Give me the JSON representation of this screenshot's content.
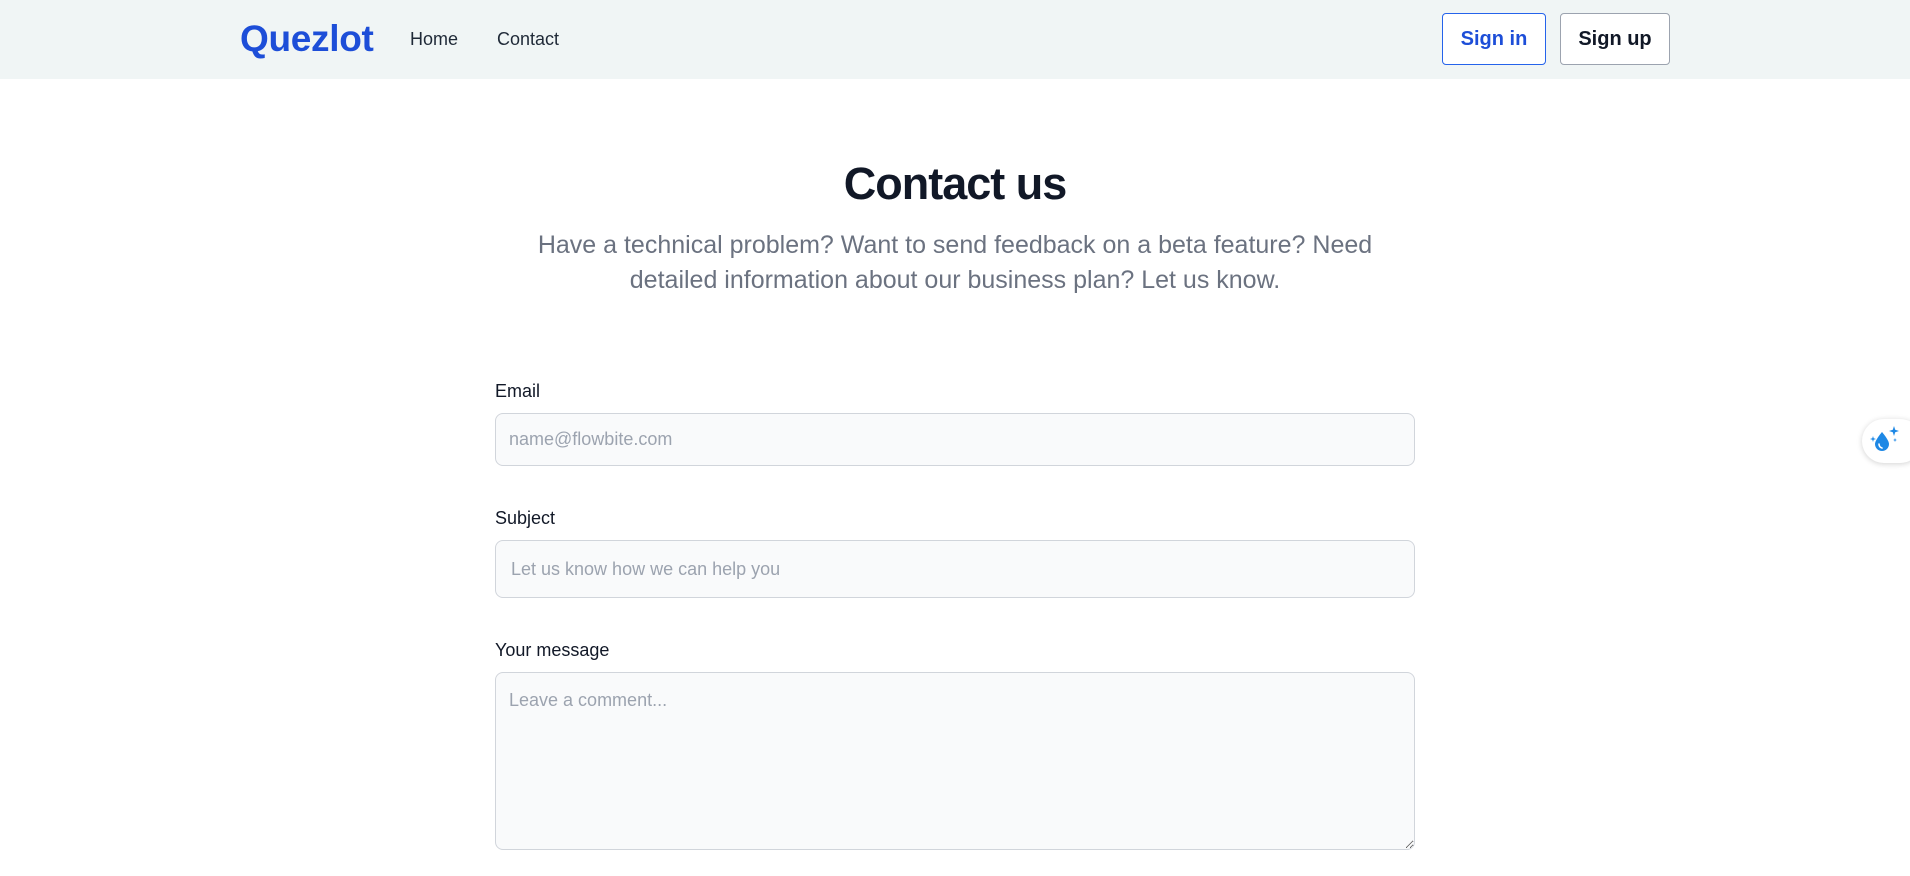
{
  "navbar": {
    "brand": "Quezlot",
    "links": [
      {
        "label": "Home"
      },
      {
        "label": "Contact"
      }
    ],
    "signin_label": "Sign in",
    "signup_label": "Sign up"
  },
  "header": {
    "title": "Contact us",
    "subtitle": "Have a technical problem? Want to send feedback on a beta feature? Need detailed information about our business plan? Let us know."
  },
  "form": {
    "email": {
      "label": "Email",
      "placeholder": "name@flowbite.com",
      "value": ""
    },
    "subject": {
      "label": "Subject",
      "placeholder": "Let us know how we can help you",
      "value": ""
    },
    "message": {
      "label": "Your message",
      "placeholder": "Leave a comment...",
      "value": ""
    }
  },
  "side_widget": {
    "icon": "sparkle-drop-icon"
  },
  "colors": {
    "brand": "#1d4ed8",
    "navbar_bg": "#f0f5f5",
    "input_bg": "#f9fafb",
    "subtitle": "#6b7280"
  }
}
